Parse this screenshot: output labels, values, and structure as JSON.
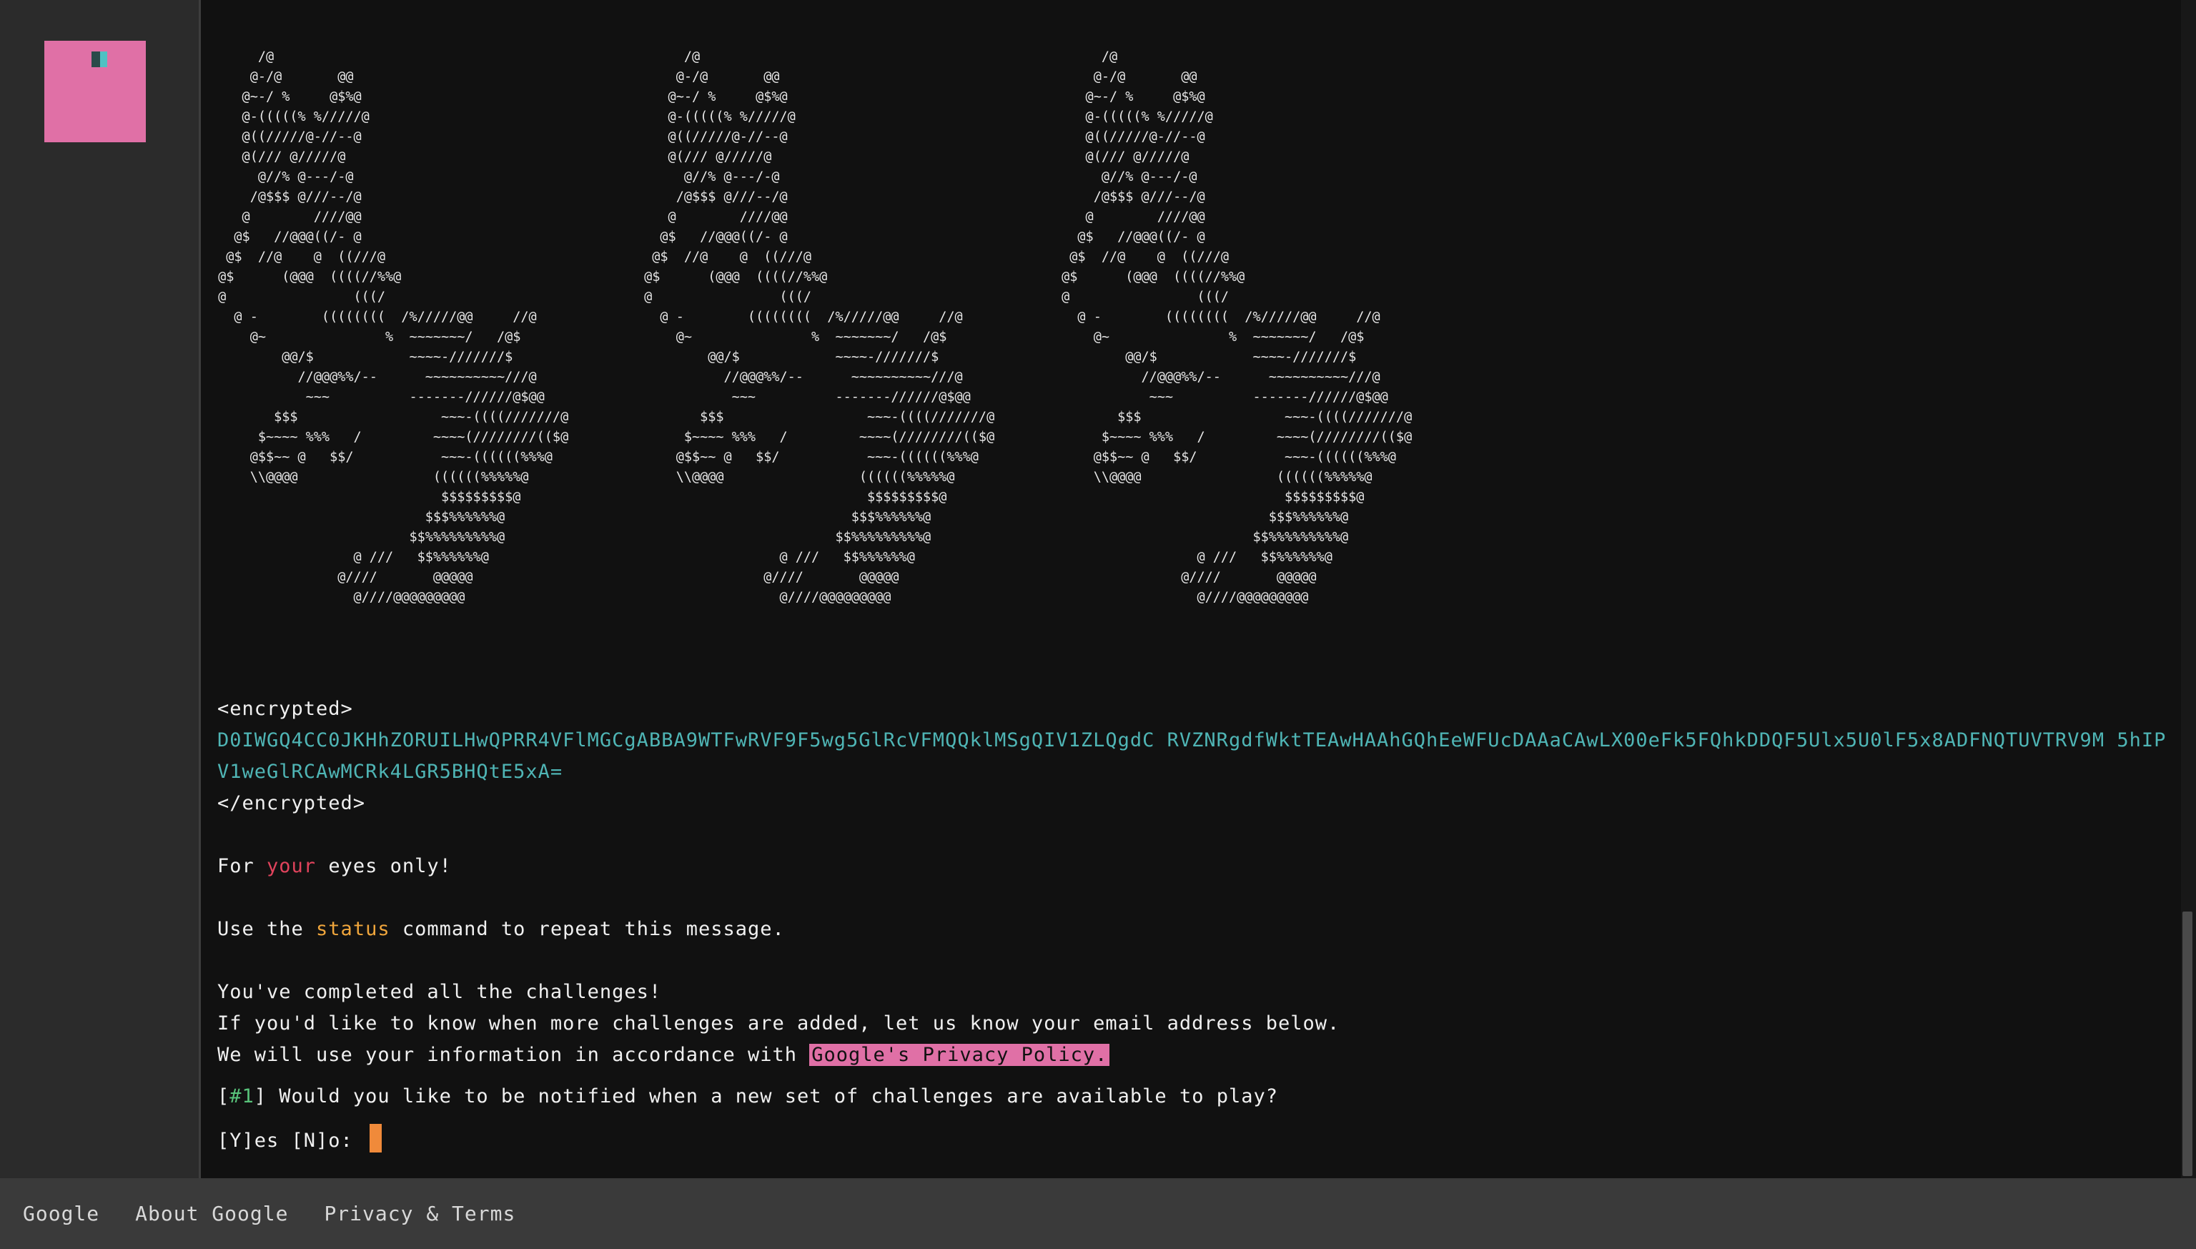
{
  "logo": {
    "icon": "pink-square-logo",
    "color": "#e070a6"
  },
  "ascii_art": {
    "lines": [
      "      /@",
      "     @-/@       @@",
      "    @~-/ %     @$%@",
      "    @-(((((% %/////@",
      "    @((/////@-//--@",
      "    @(/// @/////@",
      "      @//% @---/-@",
      "     /@$$$ @///--/@",
      "    @        ////@@",
      "   @$   //@@@((/- @",
      "  @$  //@    @  ((///@",
      " @$      (@@@  ((((//%%@",
      " @                (((/",
      "   @ -        ((((((((  /%/////@@     //@",
      "     @~               %  ~~~~~~~/   /@$",
      "         @@/$            ~~~~-///////$",
      "           //@@@%%/--      ~~~~~~~~~~///@",
      "            ~~~          -------//////@$@@",
      "        $$$                  ~~~-((((///////@",
      "      $~~~~ %%%   /         ~~~~(////////(($@",
      "     @$$~~ @   $$/           ~~~-((((((%%%@",
      "     \\\\@@@@                 ((((((%%%%%@",
      "                             $$$$$$$$$@",
      "                           $$$%%%%%%@",
      "                         $$%%%%%%%%%@",
      "                  @ ///   $$%%%%%%@",
      "                @////       @@@@@",
      "                  @////@@@@@@@@@"
    ],
    "copies": 3
  },
  "output": {
    "encrypted_open": "<encrypted>",
    "encrypted_text": "D0IWGQ4CC0JKHhZORUILHwQPRR4VFlMGCgABBA9WTFwRVF9F5wg5GlRcVFMQQklMSgQIV1ZLQgdC RVZNRgdfWktTEAwHAAhGQhEeWFUcDAAaCAwLX00eFk5FQhkDDQF5Ulx5U0lF5x8ADFNQTUVTRV9M 5hIPV1weGlRCAwMCRk4LGR5BHQtE5xA=",
    "encrypted_close": "</encrypted>",
    "eyes_pre": "For ",
    "eyes_highlight": "your",
    "eyes_post": " eyes only!",
    "status_pre": "Use the ",
    "status_cmd": "status",
    "status_post": " command to repeat this message.",
    "completed": "You've completed all the challenges!",
    "notify_info": "If you'd like to know when more challenges are added, let us know your email address below.",
    "policy_pre": "We will use your information in accordance with ",
    "policy_link": "Google's Privacy Policy.",
    "question_open": "[",
    "question_num": "#1",
    "question_close": "]",
    "question_text": " Would you like to be notified when a new set of challenges are available to play?",
    "prompt": "[Y]es [N]o: "
  },
  "footer": {
    "links": [
      "Google",
      "About Google",
      "Privacy & Terms"
    ]
  },
  "colors": {
    "background": "#111111",
    "sidebar": "#2b2b2b",
    "footer": "#3a3a3a",
    "cipher": "#4fb5b5",
    "highlight_red": "#e0435c",
    "command_orange": "#f0a63c",
    "tag_green": "#58c27a",
    "link_bg": "#e070a6",
    "cursor": "#f08a3a"
  }
}
